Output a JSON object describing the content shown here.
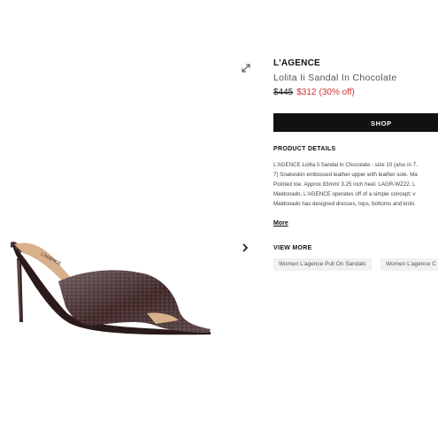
{
  "product": {
    "brand": "L'AGENCE",
    "name": "Lolita Ii Sandal In Chocolate",
    "price_old": "$445",
    "price_new": "$312",
    "discount": "(30% off)",
    "image_label": "L'AGENCE"
  },
  "actions": {
    "shop_label": "SHOP"
  },
  "details": {
    "title": "PRODUCT DETAILS",
    "lines": [
      "L'AGENCE Lolita Ii Sandal in Chocolate - size 10 (also in 7,",
      "7) Snakeskin embossed leather upper with leather sole. Ma",
      "Pointed toe. Approx 83mm/ 3.25 inch heel. LAGR-WZ22. L",
      "Maldonado, L'AGENCE operates off of a simple concept: v",
      "Maldonado has designed dresses, tops, bottoms and knits"
    ],
    "more_label": "More"
  },
  "view_more": {
    "title": "VIEW MORE",
    "tags": [
      "Women L'agence Pull On Sandals",
      "Women L'agence C"
    ]
  },
  "icons": {
    "expand": "expand-icon",
    "next": "chevron-right-icon"
  },
  "colors": {
    "accent_sale": "#d0312d",
    "button_bg": "#111111",
    "tag_bg": "#f1f1f1"
  }
}
